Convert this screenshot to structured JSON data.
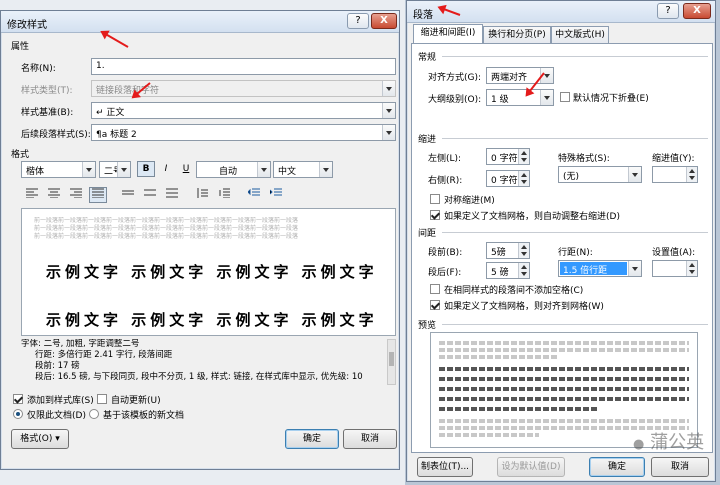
{
  "modify_style": {
    "title": "修改样式",
    "title_help": "?",
    "title_close": "X",
    "section_properties": "属性",
    "name_label": "名称(N):",
    "name_value": "1.",
    "style_type_label": "样式类型(T):",
    "style_type_value": "链接段落和字符",
    "based_on_label": "样式基准(B):",
    "based_on_value": "↵ 正文",
    "next_style_label": "后续段落样式(S):",
    "next_style_value": "¶a 标题 2",
    "section_format": "格式",
    "font_value": "楷体",
    "size_value": "二号",
    "bold": "B",
    "italic": "I",
    "underline": "U",
    "color_value": "自动",
    "script_value": "中文",
    "preview_gray_text": "前一段落前一段落前一段落前一段落前一段落前一段落前一段落前一段落前一段落前一段落前一段落",
    "preview_sample": "示例文字 示例文字 示例文字 示例文字",
    "description_lines": [
      "字体: 二号, 加粗, 字距调整二号",
      "行距: 多倍行距 2.41 字行, 段落间距",
      "段前: 17 磅",
      "段后: 16.5 磅, 与下段同页, 段中不分页, 1 级, 样式: 链接, 在样式库中显示, 优先级: 10"
    ],
    "add_to_gallery": "添加到样式库(S)",
    "add_to_gallery_checked": true,
    "auto_update": "自动更新(U)",
    "auto_update_checked": false,
    "only_this_doc": "仅限此文档(D)",
    "only_this_doc_selected": true,
    "template_docs": "基于该模板的新文档",
    "template_docs_selected": false,
    "format_button": "格式(O) ▾",
    "ok": "确定",
    "cancel": "取消"
  },
  "paragraph": {
    "title": "段落",
    "title_help": "?",
    "title_close": "X",
    "tabs": [
      "缩进和间距(I)",
      "换行和分页(P)",
      "中文版式(H)"
    ],
    "active_tab": 0,
    "section_general": "常规",
    "alignment_label": "对齐方式(G):",
    "alignment_value": "两端对齐",
    "outline_label": "大纲级别(O):",
    "outline_value": "1 级",
    "collapsed_default": "默认情况下折叠(E)",
    "collapsed_default_checked": false,
    "section_indent": "缩进",
    "left_label": "左侧(L):",
    "left_value": "0 字符",
    "right_label": "右侧(R):",
    "right_value": "0 字符",
    "special_label": "特殊格式(S):",
    "special_value": "(无)",
    "indent_by_label": "缩进值(Y):",
    "indent_by_value": "",
    "mirror_indents": "对称缩进(M)",
    "mirror_indents_checked": false,
    "auto_adjust_indent": "如果定义了文档网格，则自动调整右缩进(D)",
    "auto_adjust_indent_checked": true,
    "section_spacing": "间距",
    "before_label": "段前(B):",
    "before_value": "5磅",
    "after_label": "段后(F):",
    "after_value": "5 磅",
    "line_spacing_label": "行距(N):",
    "line_spacing_value": "1.5 倍行距",
    "at_label": "设置值(A):",
    "at_value": "",
    "dont_add_space": "在相同样式的段落间不添加空格(C)",
    "dont_add_space_checked": false,
    "snap_to_grid": "如果定义了文档网格，则对齐到网格(W)",
    "snap_to_grid_checked": true,
    "section_preview": "预览",
    "tabs_button": "制表位(T)...",
    "set_default_button": "设为默认值(D)",
    "ok": "确定",
    "cancel": "取消"
  },
  "watermark": "蒲公英",
  "colors": {
    "arrow": "#e41b1b",
    "selection": "#3399ff"
  }
}
